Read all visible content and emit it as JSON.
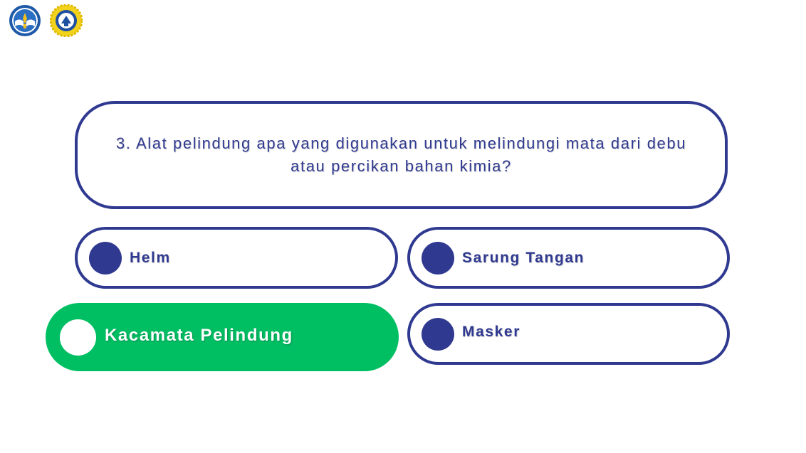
{
  "logos": [
    {
      "icon": "kemendikbud-logo-icon"
    },
    {
      "icon": "school-emblem-logo-icon"
    }
  ],
  "question": {
    "text": "3. Alat pelindung apa yang digunakan untuk melindungi mata dari debu atau percikan bahan kimia?"
  },
  "options": [
    {
      "label": "Helm",
      "selected": false
    },
    {
      "label": "Sarung Tangan",
      "selected": false
    },
    {
      "label": "Kacamata Pelindung",
      "selected": true
    },
    {
      "label": "Masker",
      "selected": false
    }
  ],
  "colors": {
    "primary": "#2f3990",
    "selected": "#00bf63",
    "background": "#ffffff"
  }
}
